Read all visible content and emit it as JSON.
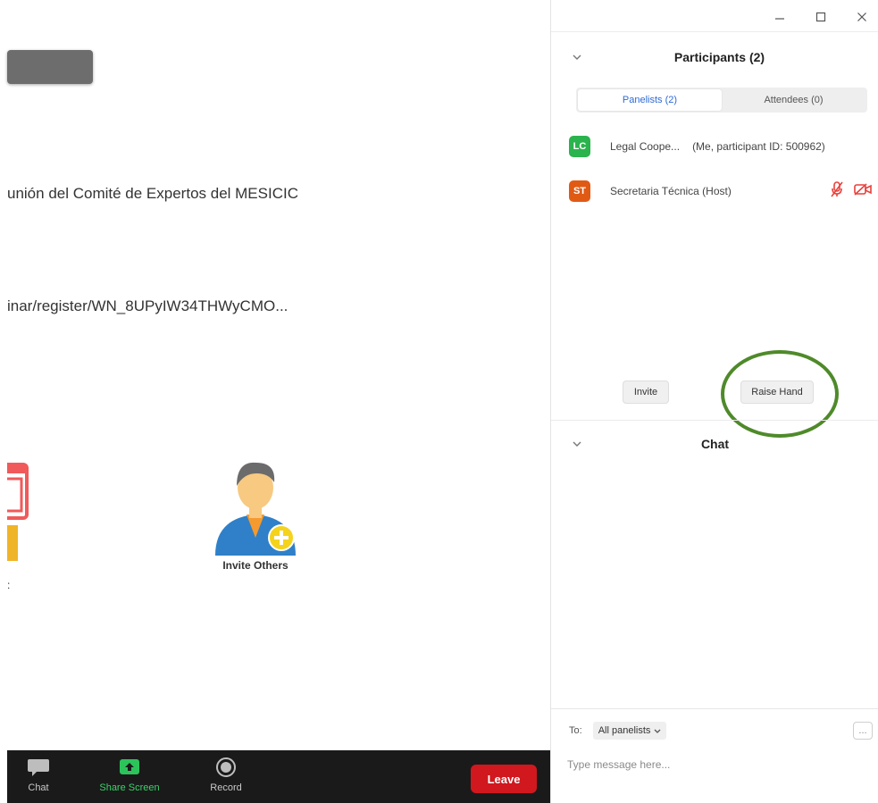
{
  "window": {
    "minimize_icon": "minimize-icon",
    "maximize_icon": "maximize-icon",
    "close_icon": "close-icon"
  },
  "main": {
    "meeting_title": "unión del Comité de Expertos del MESICIC",
    "meeting_url": "inar/register/WN_8UPyIW34THWyCMO...",
    "partial_label": ":",
    "invite_others_label": "Invite Others"
  },
  "toolbar": {
    "chat_label": "Chat",
    "share_screen_label": "Share Screen",
    "record_label": "Record",
    "leave_label": "Leave",
    "share_color": "#3ad36a",
    "leave_color": "#d0181e"
  },
  "participants": {
    "title": "Participants (2)",
    "tabs": [
      {
        "label": "Panelists (2)",
        "active": true
      },
      {
        "label": "Attendees (0)",
        "active": false
      }
    ],
    "list": [
      {
        "initials": "LC",
        "name": "Legal Coope...",
        "extra": "(Me, participant ID: 500962)",
        "color": "#2bb34d"
      },
      {
        "initials": "ST",
        "name": "Secretaria Técnica (Host)",
        "extra": "",
        "color": "#e05a14"
      }
    ],
    "invite_label": "Invite",
    "raise_hand_label": "Raise Hand"
  },
  "chat": {
    "title": "Chat",
    "to_label": "To:",
    "recipient": "All panelists",
    "more_label": "...",
    "placeholder": "Type message here..."
  },
  "highlight_color": "#4f8a2a"
}
